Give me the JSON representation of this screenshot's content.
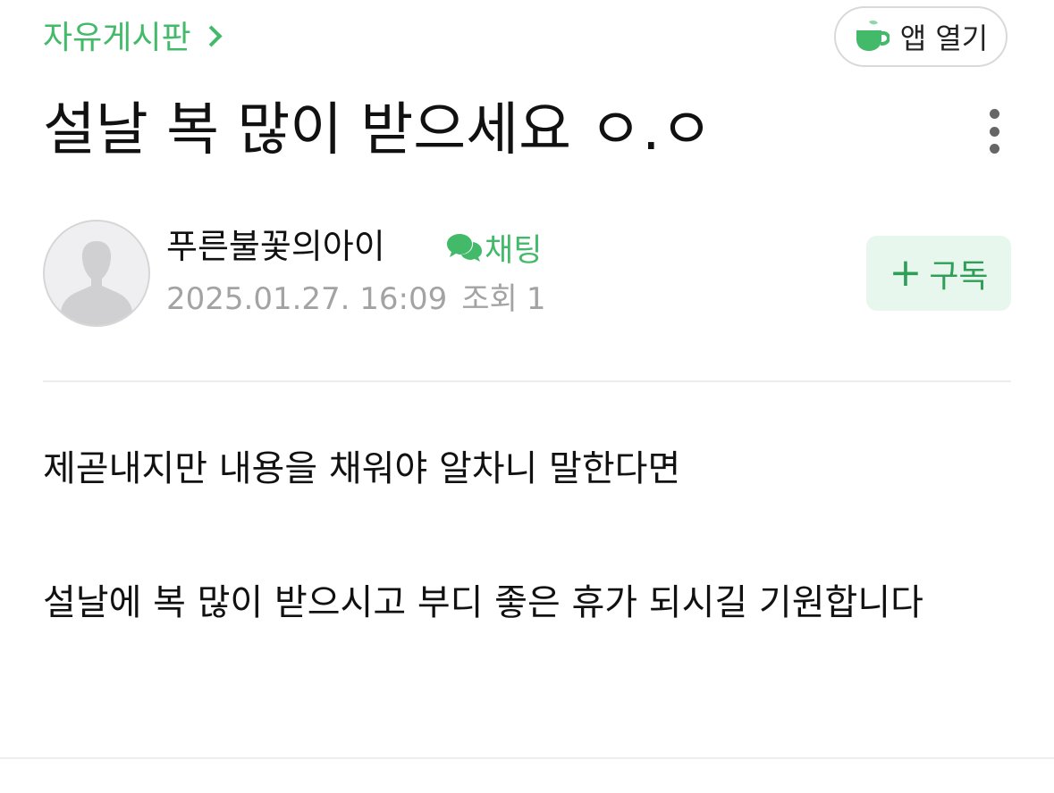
{
  "header": {
    "board_name": "자유게시판",
    "app_open_label": "앱 열기"
  },
  "post": {
    "title": "설날 복 많이 받으세요 ㅇ.ㅇ",
    "author": "푸른불꽃의아이",
    "chat_label": "채팅",
    "date": "2025.01.27. 16:09",
    "views_label": "조회",
    "views_count": "1",
    "subscribe_label": "구독",
    "subscribe_plus": "+",
    "body": [
      "제곧내지만 내용을 채워야 알차니 말한다면",
      "설날에 복 많이 받으시고 부디 좋은 휴가 되시길 기원합니다"
    ]
  },
  "icons": {
    "app": "coffee-cup-icon",
    "chat": "chat-bubbles-icon",
    "more": "more-vertical-icon",
    "chevron": "chevron-right-icon",
    "avatar": "default-user-icon"
  },
  "colors": {
    "accent": "#43b96a",
    "subscribe_bg": "#e8f7ed",
    "meta_text": "#a3a3a3"
  }
}
